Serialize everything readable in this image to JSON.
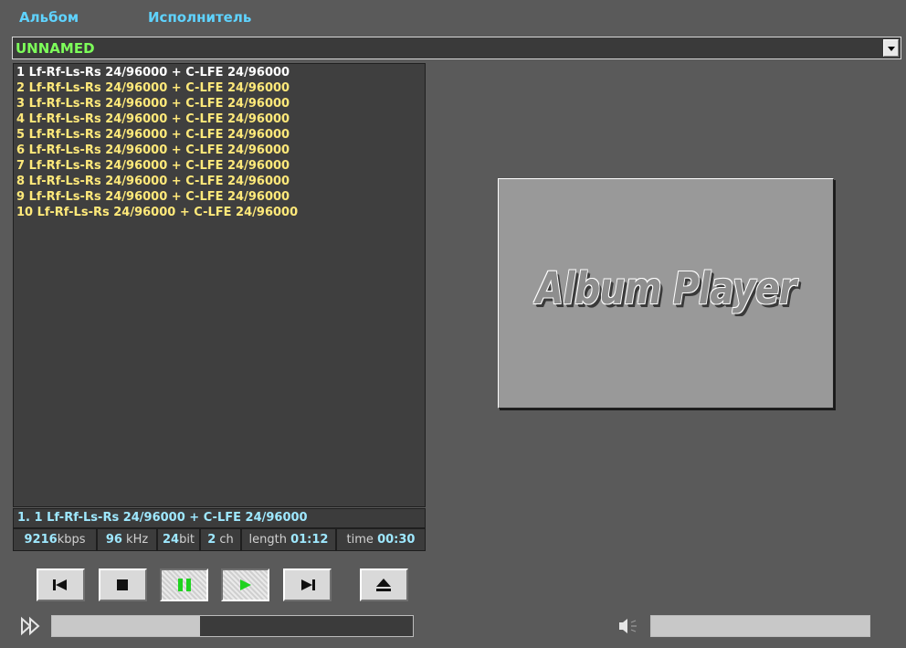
{
  "header": {
    "album_label": "Альбом",
    "artist_label": "Исполнитель"
  },
  "album_select": {
    "value": "UNNAMED"
  },
  "playlist": {
    "tracks": [
      "1  Lf-Rf-Ls-Rs 24/96000 + C-LFE 24/96000",
      "2  Lf-Rf-Ls-Rs 24/96000 + C-LFE 24/96000",
      "3  Lf-Rf-Ls-Rs 24/96000 + C-LFE 24/96000",
      "4  Lf-Rf-Ls-Rs 24/96000 + C-LFE 24/96000",
      "5  Lf-Rf-Ls-Rs 24/96000 + C-LFE 24/96000",
      "6  Lf-Rf-Ls-Rs 24/96000 + C-LFE 24/96000",
      "7  Lf-Rf-Ls-Rs 24/96000 + C-LFE 24/96000",
      "8  Lf-Rf-Ls-Rs 24/96000 + C-LFE 24/96000",
      "9  Lf-Rf-Ls-Rs 24/96000 + C-LFE 24/96000",
      "10  Lf-Rf-Ls-Rs 24/96000 + C-LFE 24/96000"
    ],
    "selected_index": 0
  },
  "now_playing": {
    "text": "1.  1  Lf-Rf-Ls-Rs 24/96000 + C-LFE 24/96000"
  },
  "stats": {
    "bitrate": "9216",
    "bitrate_unit": "kbps",
    "samplerate": "96",
    "samplerate_unit": "kHz",
    "bits": "24",
    "bits_unit": "bit",
    "channels": "2",
    "channels_unit": "ch",
    "length_label": "length",
    "length": "01:12",
    "time_label": "time",
    "time": "00:30"
  },
  "cover": {
    "text": "Album Player"
  },
  "seek": {
    "fraction": 0.41
  },
  "volume": {
    "fraction": 1.0
  },
  "icons": {
    "prev": "skip-back-icon",
    "stop": "stop-icon",
    "pause": "pause-icon",
    "play": "play-icon",
    "next": "skip-forward-icon",
    "eject": "eject-icon",
    "seek": "fast-forward-icon",
    "volume": "speaker-icon"
  },
  "colors": {
    "background": "#5a5a5a",
    "track_text": "#ffe97a",
    "selected_track_text": "#ffffff",
    "accent_cyan": "#9ee8ff",
    "header_cyan": "#5fd3ff",
    "album_green": "#7dff5a",
    "play_green": "#22dd22"
  }
}
